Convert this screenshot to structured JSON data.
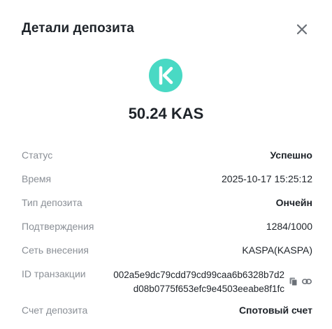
{
  "header": {
    "title": "Детали депозита"
  },
  "deposit": {
    "coin_icon": "kaspa-icon",
    "coin_color": "#49d9c4",
    "amount": "50.24 KAS"
  },
  "details": {
    "status_label": "Статус",
    "status_value": "Успешно",
    "time_label": "Время",
    "time_value": "2025-10-17 15:25:12",
    "type_label": "Тип депозита",
    "type_value": "Ончейн",
    "confirmations_label": "Подтверждения",
    "confirmations_value": "1284/1000",
    "network_label": "Сеть внесения",
    "network_value": "KASPA(KASPA)",
    "txid_label": "ID транзакции",
    "txid_line1": "002a5e9dc79cdd79cd99caa6b6328b7d2",
    "txid_line2": "d08b0775f653efc9e4503eeabe8f1fc",
    "account_label": "Счет депозита",
    "account_value": "Спотовый счет"
  },
  "icons": {
    "close": "close-icon",
    "copy": "copy-icon",
    "link": "link-icon"
  }
}
